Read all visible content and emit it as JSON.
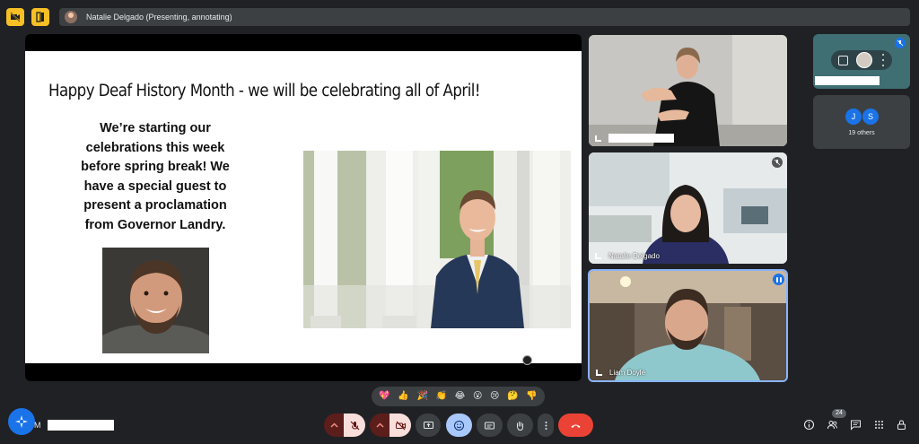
{
  "presenter_bar": {
    "text": "Natalie Delgado (Presenting, annotating)"
  },
  "slide": {
    "title": "Happy Deaf History Month - we will be celebrating all of April!",
    "body_lines": [
      "We’re starting our",
      "celebrations this week",
      "before spring break! We",
      "have a special guest to",
      "present a proclamation",
      "from Governor Landry."
    ]
  },
  "tiles": {
    "natalie": {
      "name": "Natalie Delgado"
    },
    "liam": {
      "name": "Liam Doyle"
    }
  },
  "others": {
    "initial_1": "J",
    "initial_2": "S",
    "label": "19 others"
  },
  "reactions": [
    "💖",
    "👍",
    "🎉",
    "👏",
    "😂",
    "😮",
    "😢",
    "🤔",
    "👎"
  ],
  "bottom": {
    "user_initial": "M",
    "participant_count": "24"
  },
  "colors": {
    "accent": "#1a73e8",
    "danger": "#ea4335",
    "highlight": "#f6bf26",
    "background": "#202124"
  },
  "icons": [
    "hide-video-icon",
    "layout-icon",
    "raise-hand-icon",
    "present-icon",
    "emoji-icon",
    "captions-icon",
    "end-call-icon",
    "info-icon",
    "people-icon",
    "chat-icon",
    "activities-icon",
    "host-controls-icon"
  ]
}
